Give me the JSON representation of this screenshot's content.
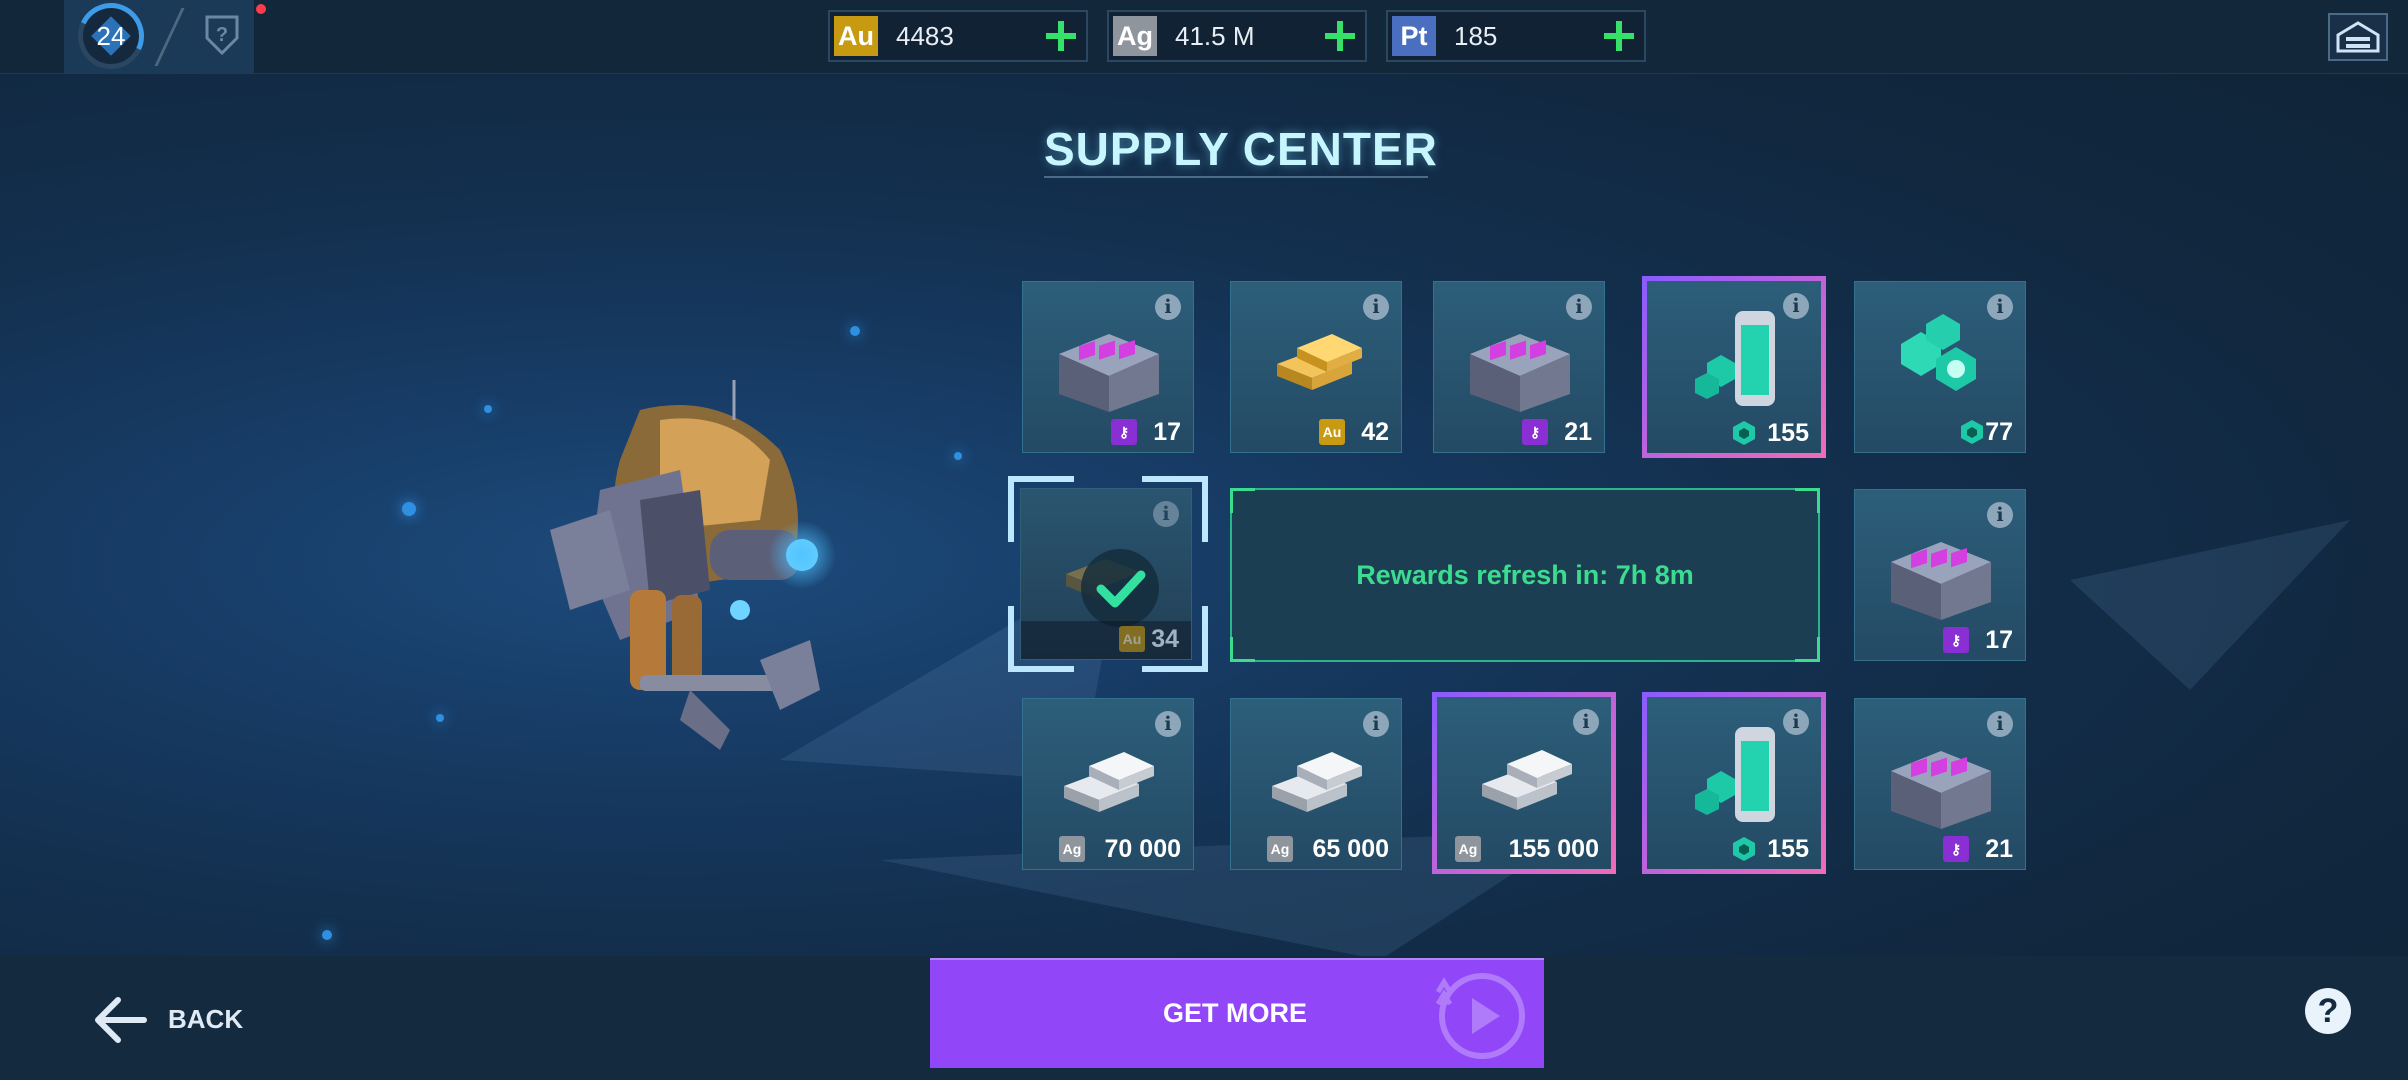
{
  "topbar": {
    "level": "24",
    "currencies": [
      {
        "code": "Au",
        "value": "4483",
        "color": "#c89a12"
      },
      {
        "code": "Ag",
        "value": "41.5 M",
        "color": "#8f959c"
      },
      {
        "code": "Pt",
        "value": "185",
        "color": "#4a6fc0"
      }
    ]
  },
  "title": "SUPPLY CENTER",
  "grid": {
    "row1": [
      {
        "item": "key-crate",
        "currency": "key",
        "qty": "17"
      },
      {
        "item": "gold-bars",
        "currency": "Au",
        "qty": "42"
      },
      {
        "item": "key-crate",
        "currency": "key",
        "qty": "21"
      },
      {
        "item": "hex-canister",
        "currency": "hex",
        "qty": "155",
        "highlight": true
      },
      {
        "item": "hex-tokens",
        "currency": "hex",
        "qty": "77"
      }
    ],
    "row2": {
      "claimed": {
        "currency": "Au",
        "qty": "34"
      },
      "refresh_label": "Rewards refresh in: 7h 8m",
      "right": {
        "item": "key-crate",
        "currency": "key",
        "qty": "17"
      }
    },
    "row3": [
      {
        "item": "silver-bars",
        "currency": "Ag",
        "qty": "70 000"
      },
      {
        "item": "silver-bars",
        "currency": "Ag",
        "qty": "65 000"
      },
      {
        "item": "silver-bars",
        "currency": "Ag",
        "qty": "155 000",
        "highlight": true
      },
      {
        "item": "hex-canister",
        "currency": "hex",
        "qty": "155",
        "highlight": true
      },
      {
        "item": "key-crate",
        "currency": "key",
        "qty": "21"
      }
    ]
  },
  "bottombar": {
    "back_label": "BACK",
    "get_more_label": "GET MORE",
    "help_label": "?"
  },
  "colors": {
    "accent_purple": "#9146f8",
    "refresh_green": "#3bdc8f",
    "plus_green": "#35e06b"
  }
}
